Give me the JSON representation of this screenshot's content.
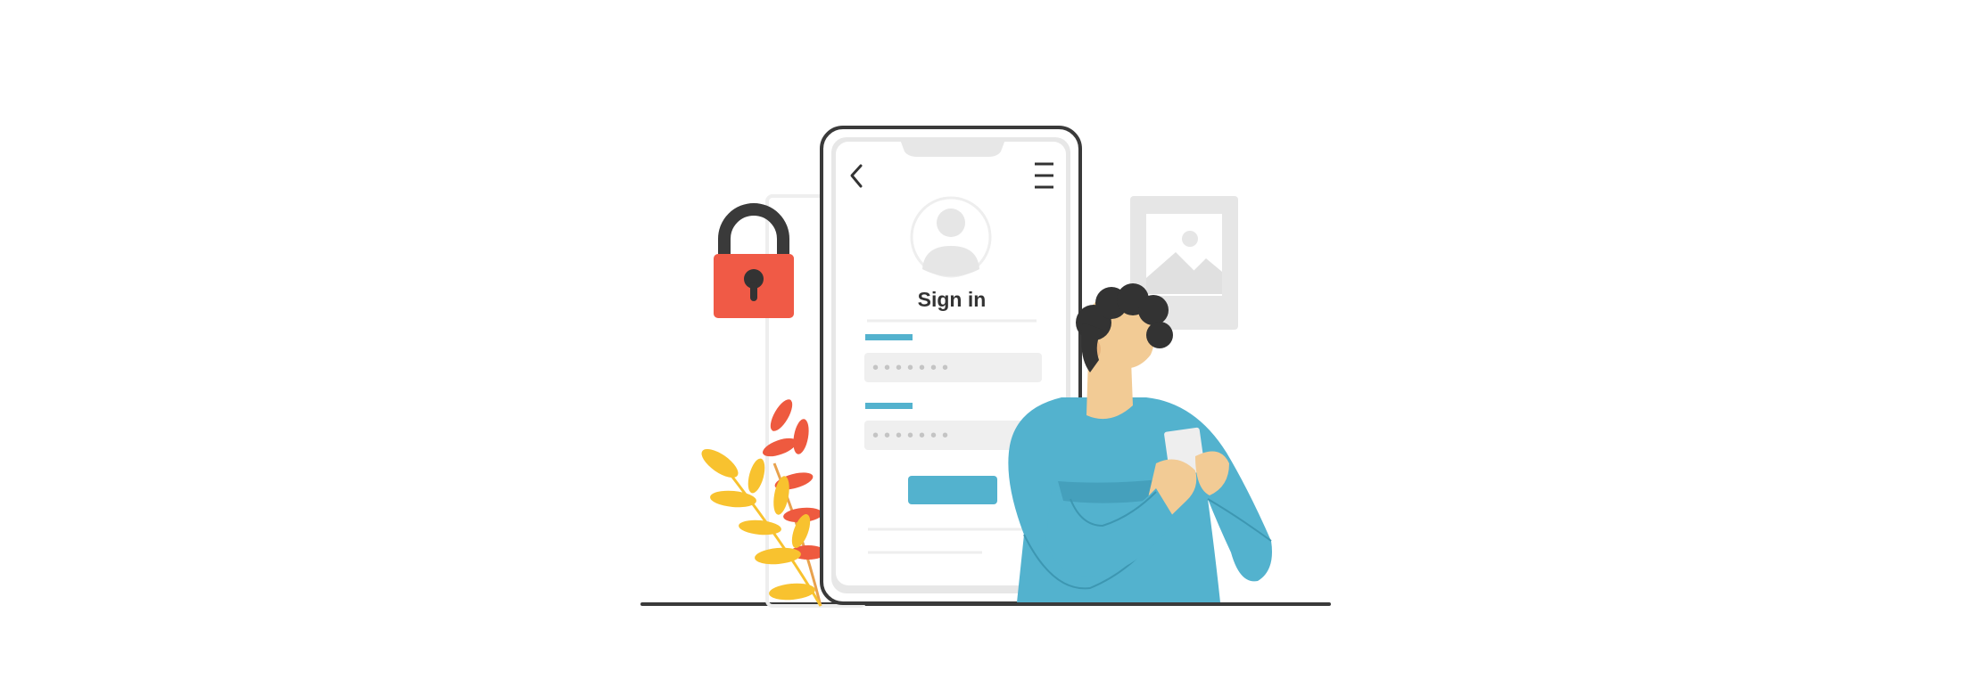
{
  "screen": {
    "title": "Sign in",
    "password_mask_1": "•••••••",
    "password_mask_2": "•••••••",
    "icons": {
      "back": "chevron-left-icon",
      "menu": "hamburger-menu-icon",
      "avatar": "user-avatar-icon"
    }
  },
  "colors": {
    "accent": "#53B2CE",
    "lock": "#F05A46",
    "outline": "#3A3A3A",
    "leaf_yellow": "#F8C22F",
    "leaf_red": "#EE5A3F",
    "skin": "#F2CB95",
    "hair": "#333333",
    "placeholder_gray": "#E6E6E6"
  }
}
